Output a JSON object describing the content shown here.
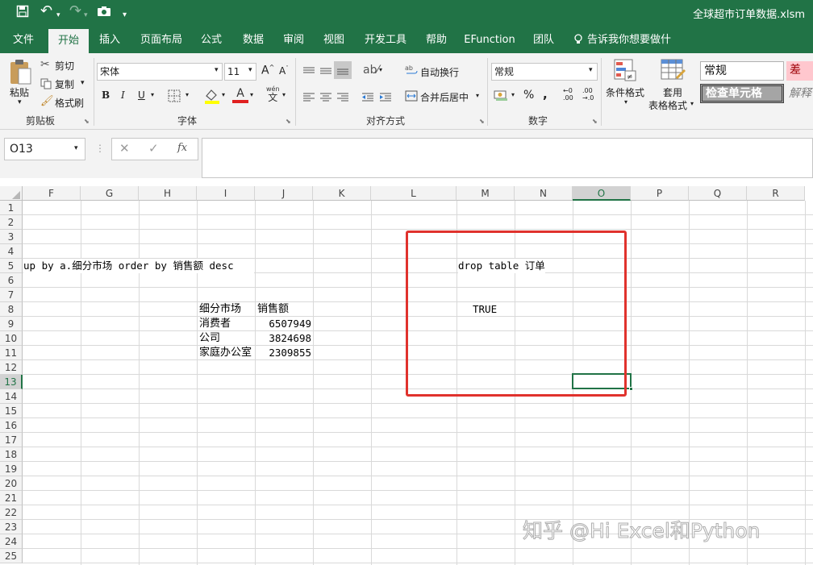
{
  "window": {
    "title": "全球超市订单数据.xlsm"
  },
  "tabs": [
    {
      "label": "文件"
    },
    {
      "label": "开始"
    },
    {
      "label": "插入"
    },
    {
      "label": "页面布局"
    },
    {
      "label": "公式"
    },
    {
      "label": "数据"
    },
    {
      "label": "审阅"
    },
    {
      "label": "视图"
    },
    {
      "label": "开发工具"
    },
    {
      "label": "帮助"
    },
    {
      "label": "EFunction"
    },
    {
      "label": "团队"
    }
  ],
  "tell_me": "告诉我你想要做什么",
  "clipboard": {
    "paste": "粘贴",
    "cut": "剪切",
    "copy": "复制",
    "format_painter": "格式刷",
    "group": "剪贴板"
  },
  "font": {
    "name": "宋体",
    "size": "11",
    "group": "字体",
    "bold": "B",
    "italic": "I",
    "underline": "U",
    "wen": "wén",
    "wen_char": "文"
  },
  "alignment": {
    "wrap": "自动换行",
    "merge": "合并后居中",
    "group": "对齐方式"
  },
  "number": {
    "format": "常规",
    "group": "数字",
    "percent": "%",
    "comma": ","
  },
  "styles": {
    "conditional": "条件格式",
    "table_1": "套用",
    "table_2": "表格格式",
    "normal": "常规",
    "bad": "差",
    "check": "检查单元格",
    "explain": "解释"
  },
  "formula_bar": {
    "name_box": "O13",
    "fx": "fx",
    "value": ""
  },
  "columns": [
    "F",
    "G",
    "H",
    "I",
    "J",
    "K",
    "L",
    "M",
    "N",
    "O",
    "P",
    "Q",
    "R"
  ],
  "rows": [
    "1",
    "2",
    "3",
    "4",
    "5",
    "6",
    "7",
    "8",
    "9",
    "10",
    "11",
    "12",
    "13",
    "14",
    "15",
    "16",
    "17",
    "18",
    "19",
    "20",
    "21",
    "22",
    "23",
    "24",
    "25"
  ],
  "selected_cell": "O13",
  "cells": {
    "row5_sql": "up by a.细分市场 order by 销售额 desc",
    "row5_drop": "drop table 订单",
    "row8_true": "TRUE",
    "header_segment": "细分市场",
    "header_sales": "销售额",
    "data": [
      {
        "segment": "消费者",
        "sales": "6507949"
      },
      {
        "segment": "公司",
        "sales": "3824698"
      },
      {
        "segment": "家庭办公室",
        "sales": "2309855"
      }
    ]
  },
  "watermark": "知乎 @Hi Excel和Python",
  "colors": {
    "brand": "#217346",
    "highlight_box": "#e0322d"
  }
}
